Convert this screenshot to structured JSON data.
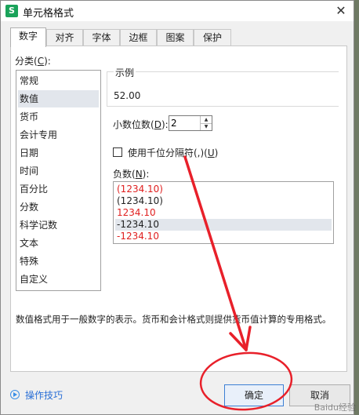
{
  "window": {
    "title": "单元格格式",
    "app_icon_letter": "S",
    "close_glyph": "✕"
  },
  "tabs": [
    {
      "label": "数字",
      "active": true
    },
    {
      "label": "对齐",
      "active": false
    },
    {
      "label": "字体",
      "active": false
    },
    {
      "label": "边框",
      "active": false
    },
    {
      "label": "图案",
      "active": false
    },
    {
      "label": "保护",
      "active": false
    }
  ],
  "category": {
    "label": "分类(",
    "hotkey": "C",
    "label_tail": "):",
    "items": [
      "常规",
      "数值",
      "货币",
      "会计专用",
      "日期",
      "时间",
      "百分比",
      "分数",
      "科学记数",
      "文本",
      "特殊",
      "自定义"
    ],
    "selected": "数值"
  },
  "sample": {
    "caption": "示例",
    "value": "52.00"
  },
  "decimal": {
    "label": "小数位数(",
    "hotkey": "D",
    "label_tail": "):",
    "value": "2"
  },
  "thousands": {
    "label": "使用千位分隔符(,)(",
    "hotkey": "U",
    "label_tail": ")",
    "checked": false
  },
  "negative": {
    "label": "负数(",
    "hotkey": "N",
    "label_tail": "):",
    "items": [
      {
        "text": "(1234.10)",
        "color": "#e02020"
      },
      {
        "text": "(1234.10)",
        "color": "#222222"
      },
      {
        "text": "1234.10",
        "color": "#e02020"
      },
      {
        "text": "-1234.10",
        "color": "#222222"
      },
      {
        "text": "-1234.10",
        "color": "#e02020"
      }
    ],
    "selected_index": 3
  },
  "description": "数值格式用于一般数字的表示。货币和会计格式则提供货币值计算的专用格式。",
  "footer": {
    "tips": "操作技巧",
    "ok": "确定",
    "cancel": "取消"
  },
  "watermark": "Baidu经验",
  "colors": {
    "accent": "#3c7fd4",
    "annotation_red": "#e8202a",
    "negative_red": "#e02020"
  }
}
